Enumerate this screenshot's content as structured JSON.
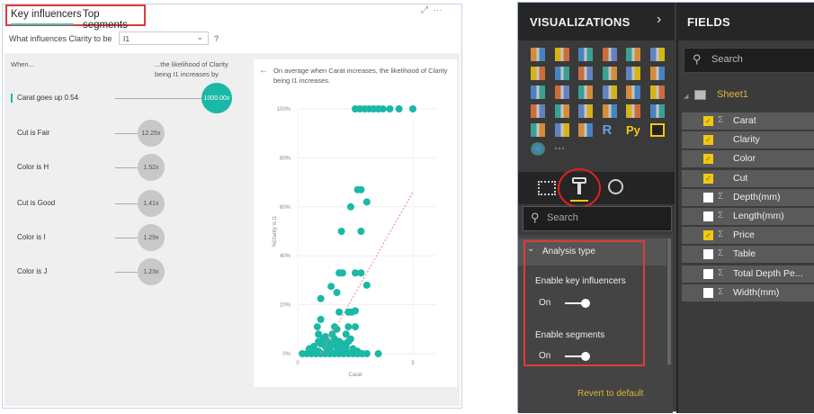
{
  "tabs": {
    "key_influencers": "Key influencers",
    "top_segments": "Top segments"
  },
  "question": {
    "label": "What influences Clarity to be",
    "value": "I1",
    "help": "?"
  },
  "header_icons": {
    "expand": "⤢",
    "more": "···"
  },
  "influencers": {
    "when_label": "When...",
    "likelihood_label_1": "...the likelihood of Clarity",
    "likelihood_label_2": "being I1 increases by",
    "items": [
      {
        "label": "Carat goes up 0.54",
        "value": "1000.00x",
        "selected": true
      },
      {
        "label": "Cut is Fair",
        "value": "12.25x"
      },
      {
        "label": "Color is H",
        "value": "1.52x"
      },
      {
        "label": "Cut is Good",
        "value": "1.41x"
      },
      {
        "label": "Color is I",
        "value": "1.29x"
      },
      {
        "label": "Color is J",
        "value": "1.23x"
      }
    ]
  },
  "detail": {
    "back_icon": "←",
    "text_1": "On average when Carat increases, the likelihood of Clarity",
    "text_2": "being I1 increases."
  },
  "chart_data": {
    "type": "scatter",
    "xlabel": "Carat",
    "ylabel": "%Clarity is I1",
    "xlim": [
      0,
      6
    ],
    "ylim": [
      0,
      100
    ],
    "xticks": [
      {
        "v": 0,
        "label": "0"
      },
      {
        "v": 5,
        "label": "5"
      }
    ],
    "yticks": [
      {
        "v": 0,
        "label": "0%"
      },
      {
        "v": 20,
        "label": "20%"
      },
      {
        "v": 40,
        "label": "40%"
      },
      {
        "v": 60,
        "label": "60%"
      },
      {
        "v": 80,
        "label": "80%"
      },
      {
        "v": 100,
        "label": "100%"
      }
    ],
    "color": "#1ab8a6",
    "trend_color": "#f08080",
    "trend": [
      [
        1.0,
        0
      ],
      [
        5.0,
        66
      ]
    ],
    "points": [
      [
        2.5,
        100
      ],
      [
        2.7,
        100
      ],
      [
        2.9,
        100
      ],
      [
        3.1,
        100
      ],
      [
        3.3,
        100
      ],
      [
        3.5,
        100
      ],
      [
        3.7,
        100
      ],
      [
        4.0,
        100
      ],
      [
        4.4,
        100
      ],
      [
        5.0,
        100
      ],
      [
        2.6,
        67
      ],
      [
        2.75,
        67
      ],
      [
        3.0,
        62
      ],
      [
        2.3,
        60
      ],
      [
        1.9,
        50
      ],
      [
        2.75,
        50
      ],
      [
        1.8,
        33
      ],
      [
        1.95,
        33
      ],
      [
        2.5,
        33
      ],
      [
        2.75,
        33
      ],
      [
        3.0,
        28
      ],
      [
        1.45,
        27.5
      ],
      [
        1.7,
        25
      ],
      [
        1.0,
        22.5
      ],
      [
        1.8,
        17
      ],
      [
        2.2,
        17
      ],
      [
        2.35,
        17
      ],
      [
        2.5,
        17.5
      ],
      [
        1.0,
        14
      ],
      [
        0.85,
        11
      ],
      [
        1.6,
        11
      ],
      [
        1.7,
        10
      ],
      [
        2.2,
        11
      ],
      [
        2.5,
        11
      ],
      [
        0.9,
        8
      ],
      [
        1.2,
        7
      ],
      [
        1.5,
        8
      ],
      [
        2.1,
        8
      ],
      [
        2.3,
        6
      ],
      [
        0.5,
        2
      ],
      [
        0.7,
        3
      ],
      [
        0.9,
        5
      ],
      [
        1.0,
        4
      ],
      [
        1.1,
        6
      ],
      [
        1.2,
        3
      ],
      [
        1.3,
        5
      ],
      [
        1.4,
        2
      ],
      [
        1.5,
        4
      ],
      [
        1.6,
        6
      ],
      [
        1.7,
        3
      ],
      [
        1.8,
        5
      ],
      [
        1.9,
        2
      ],
      [
        2.0,
        4
      ],
      [
        2.1,
        3
      ],
      [
        2.2,
        5
      ],
      [
        2.4,
        2
      ],
      [
        2.6,
        1
      ],
      [
        0.2,
        0
      ],
      [
        0.4,
        0
      ],
      [
        0.6,
        0
      ],
      [
        0.8,
        0
      ],
      [
        1.0,
        0
      ],
      [
        1.2,
        0
      ],
      [
        1.4,
        0
      ],
      [
        1.6,
        0
      ],
      [
        1.8,
        0
      ],
      [
        2.0,
        0
      ],
      [
        2.2,
        0
      ],
      [
        2.4,
        0
      ],
      [
        2.6,
        0
      ],
      [
        2.8,
        0
      ],
      [
        3.0,
        0
      ],
      [
        3.5,
        0
      ],
      [
        0.6,
        1
      ],
      [
        0.9,
        1
      ],
      [
        1.3,
        1
      ],
      [
        1.7,
        1
      ],
      [
        2.1,
        1
      ]
    ]
  },
  "visualizations": {
    "title": "VISUALIZATIONS",
    "chevron": "›",
    "more": "···",
    "r_label": "R",
    "py_label": "Py"
  },
  "format": {
    "search_placeholder": "Search",
    "section": "Analysis type",
    "enable_ki": "Enable key influencers",
    "enable_ki_state": "On",
    "enable_seg": "Enable segments",
    "enable_seg_state": "On",
    "revert": "Revert to default"
  },
  "fields": {
    "title": "FIELDS",
    "search_placeholder": "Search",
    "table": "Sheet1",
    "items": [
      {
        "name": "Carat",
        "checked": true,
        "sigma": true
      },
      {
        "name": "Clarity",
        "checked": true,
        "sigma": false
      },
      {
        "name": "Color",
        "checked": true,
        "sigma": false
      },
      {
        "name": "Cut",
        "checked": true,
        "sigma": false
      },
      {
        "name": "Depth(mm)",
        "checked": false,
        "sigma": true
      },
      {
        "name": "Length(mm)",
        "checked": false,
        "sigma": true
      },
      {
        "name": "Price",
        "checked": true,
        "sigma": true
      },
      {
        "name": "Table",
        "checked": false,
        "sigma": true
      },
      {
        "name": "Total Depth Pe...",
        "checked": false,
        "sigma": true
      },
      {
        "name": "Width(mm)",
        "checked": false,
        "sigma": true
      }
    ]
  }
}
